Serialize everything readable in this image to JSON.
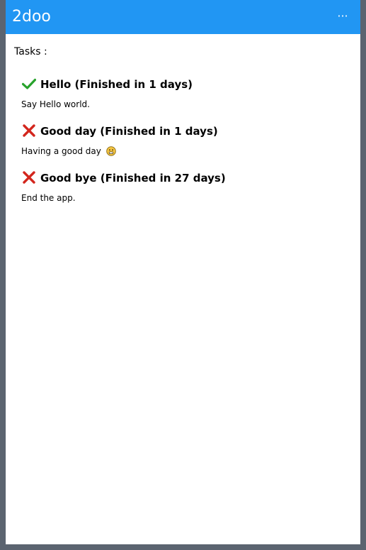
{
  "app": {
    "title": "2doo",
    "more_label": "···"
  },
  "tasks_label": "Tasks :",
  "tasks": [
    {
      "status": "done",
      "status_icon": "check-icon",
      "title": "Hello (Finished in 1 days)",
      "description": "Say Hello world."
    },
    {
      "status": "not-done",
      "status_icon": "cross-icon",
      "title": "Good day (Finished in 1 days)",
      "description": "Having a good day",
      "description_emoji": "smiley-icon"
    },
    {
      "status": "not-done",
      "status_icon": "cross-icon",
      "title": "Good bye (Finished in 27 days)",
      "description": "End the app."
    }
  ],
  "colors": {
    "header": "#2196f3",
    "frame": "#5b6470",
    "check": "#27a22b",
    "cross": "#d3261d"
  }
}
